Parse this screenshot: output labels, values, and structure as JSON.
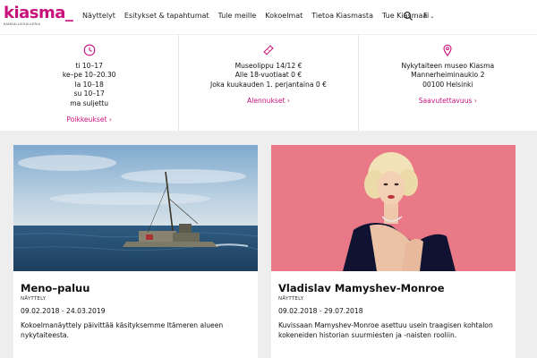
{
  "header": {
    "logo_text": "kiasma",
    "logo_underscore": "_",
    "logo_subtitle": "KANSALLISGALLERIA",
    "nav": [
      "Näyttelyt",
      "Esitykset & tapahtumat",
      "Tule meille",
      "Kokoelmat",
      "Tietoa Kiasmasta",
      "Tue Kiasmaa"
    ],
    "language": "Fi",
    "colors": {
      "brand": "#c8117a"
    }
  },
  "info": {
    "hours": {
      "icon": "clock-icon",
      "lines": [
        "ti 10–17",
        "ke–pe 10–20.30",
        "la 10–18",
        "su 10–17",
        "ma suljettu"
      ],
      "link": "Poikkeukset ›"
    },
    "tickets": {
      "icon": "ticket-icon",
      "lines": [
        "Museolippu 14/12 €",
        "Alle 18-vuotiaat 0 €",
        "Joka kuukauden 1. perjantaina 0 €"
      ],
      "link": "Alennukset ›"
    },
    "location": {
      "icon": "location-pin-icon",
      "lines": [
        "Nykytaiteen museo Kiasma",
        "Mannerheiminaukio 2",
        "00100 Helsinki"
      ],
      "link": "Saavutettavuus ›"
    }
  },
  "cards": [
    {
      "title": "Meno–paluu",
      "type": "NÄYTTELY",
      "dates": "09.02.2018 - 24.03.2019",
      "description": "Kokoelmanäyttely päivittää käsityksemme Itämeren alueen nykytaiteesta."
    },
    {
      "title": "Vladislav Mamyshev-Monroe",
      "type": "NÄYTTELY",
      "dates": "09.02.2018 - 29.07.2018",
      "description": "Kuvissaan Mamyshev-Monroe asettuu usein traagisen kohtalon kokeneiden historian suurmiesten ja -naisten rooliin."
    }
  ]
}
